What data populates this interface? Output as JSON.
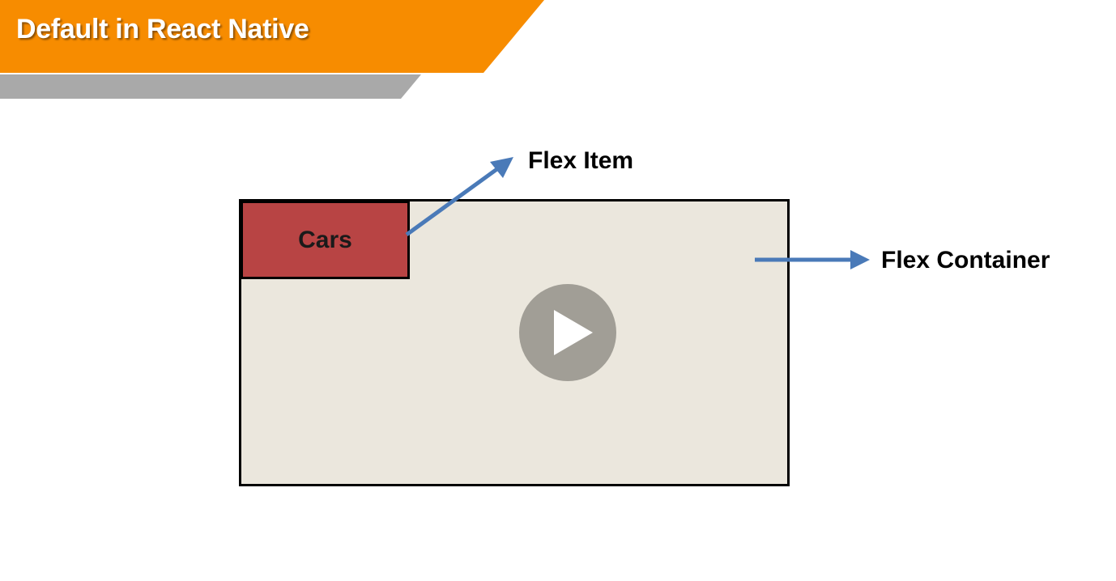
{
  "slide": {
    "title": "Default in React Native",
    "banner_color": "#f78c00",
    "banner_shadow_color": "#a9a9a9"
  },
  "diagram": {
    "container_label": "Flex Container",
    "item_label": "Flex Item",
    "item_text": "Cars",
    "container_color": "#ebe7dd",
    "item_color": "#b84444",
    "arrow_color": "#4a7ab8"
  },
  "video": {
    "play_icon": "play-icon"
  }
}
